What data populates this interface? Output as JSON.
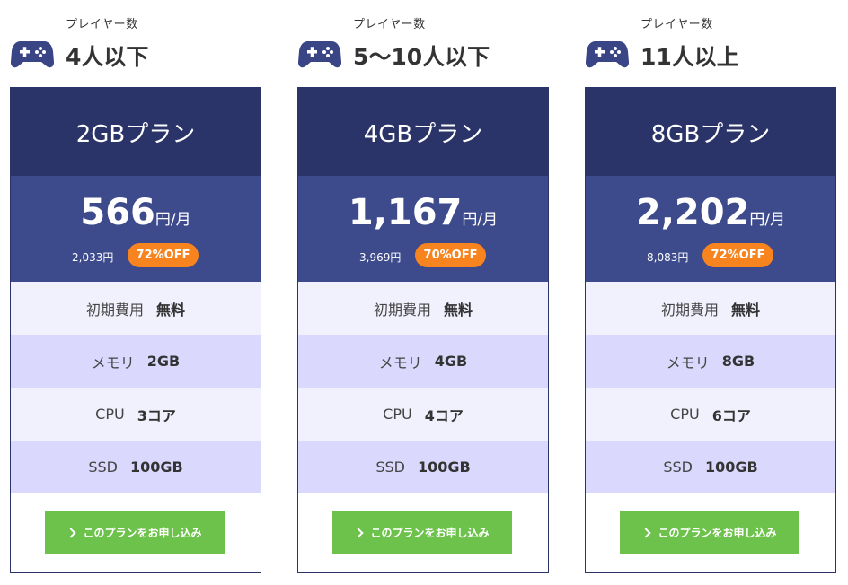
{
  "accent_colors": {
    "header_bg": "#2b3468",
    "price_bg": "#3d4a8c",
    "discount_badge": "#f7841e",
    "row_light": "#f1f0fd",
    "row_dark": "#dbd8fd",
    "apply_button": "#6cc24a",
    "icon": "#3a4586"
  },
  "plans": [
    {
      "players_caption": "プレイヤー数",
      "players_count": "4人以下",
      "players_icon": "gamepad-icon",
      "plan_name": "2GBプラン",
      "price": "566",
      "price_unit": "円/月",
      "regular_price": "2,033円",
      "discount": "72%OFF",
      "specs": [
        {
          "label": "初期費用",
          "value": "無料"
        },
        {
          "label": "メモリ",
          "value": "2GB"
        },
        {
          "label": "CPU",
          "value": "3コア"
        },
        {
          "label": "SSD",
          "value": "100GB"
        }
      ],
      "apply_label": "このプランをお申し込み",
      "apply_icon": "chevron-right-icon"
    },
    {
      "players_caption": "プレイヤー数",
      "players_count": "5〜10人以下",
      "players_icon": "gamepad-icon",
      "plan_name": "4GBプラン",
      "price": "1,167",
      "price_unit": "円/月",
      "regular_price": "3,969円",
      "discount": "70%OFF",
      "specs": [
        {
          "label": "初期費用",
          "value": "無料"
        },
        {
          "label": "メモリ",
          "value": "4GB"
        },
        {
          "label": "CPU",
          "value": "4コア"
        },
        {
          "label": "SSD",
          "value": "100GB"
        }
      ],
      "apply_label": "このプランをお申し込み",
      "apply_icon": "chevron-right-icon"
    },
    {
      "players_caption": "プレイヤー数",
      "players_count": "11人以上",
      "players_icon": "gamepad-icon",
      "plan_name": "8GBプラン",
      "price": "2,202",
      "price_unit": "円/月",
      "regular_price": "8,083円",
      "discount": "72%OFF",
      "specs": [
        {
          "label": "初期費用",
          "value": "無料"
        },
        {
          "label": "メモリ",
          "value": "8GB"
        },
        {
          "label": "CPU",
          "value": "6コア"
        },
        {
          "label": "SSD",
          "value": "100GB"
        }
      ],
      "apply_label": "このプランをお申し込み",
      "apply_icon": "chevron-right-icon"
    }
  ]
}
